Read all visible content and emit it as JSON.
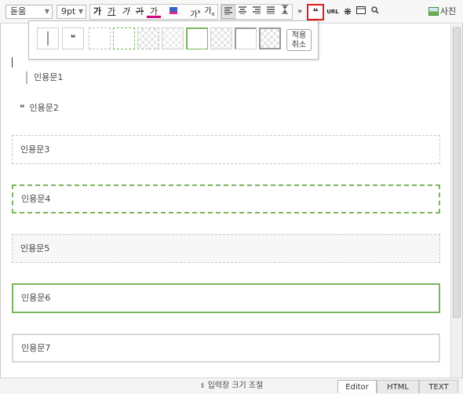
{
  "toolbar": {
    "font_name": "돋움",
    "font_size": "9pt",
    "bold": "가",
    "underline": "가",
    "italic": "가",
    "strike": "가",
    "text_color": "가",
    "superscript": "가",
    "subscript": "가",
    "more": "»",
    "quote": "❝",
    "url": "URL",
    "photo": "사진"
  },
  "dropdown": {
    "apply_line1": "적용",
    "apply_line2": "취소"
  },
  "editor": {
    "quotes": [
      "인용문1",
      "인용문2",
      "인용문3",
      "인용문4",
      "인용문5",
      "인용문6",
      "인용문7"
    ]
  },
  "bottom": {
    "resize_label": "입력창 크기 조절",
    "tabs": [
      "Editor",
      "HTML",
      "TEXT"
    ],
    "active_tab": "Editor"
  },
  "colors": {
    "highlight_red": "#e01b1b",
    "quote_green": "#7bb55c"
  }
}
